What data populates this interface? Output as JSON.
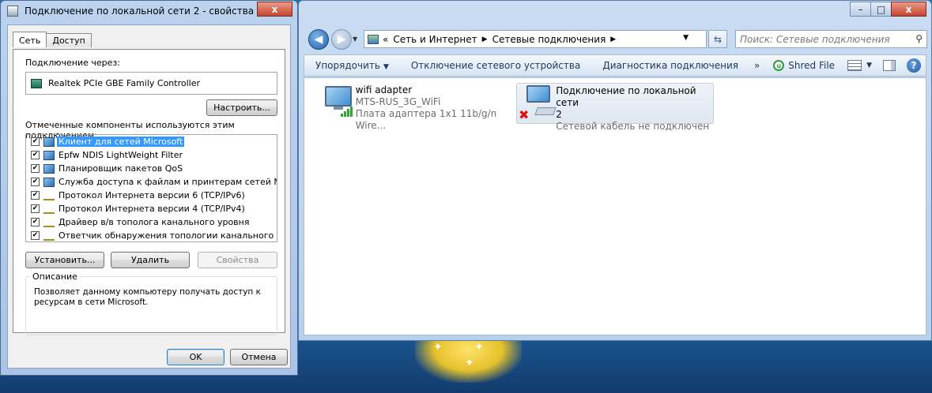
{
  "dialog": {
    "title": "Подключение по локальной сети 2 - свойства",
    "close_label": "x",
    "tabs": [
      {
        "label": "Сеть"
      },
      {
        "label": "Доступ"
      }
    ],
    "connect_using_label": "Подключение через:",
    "adapter_name": "Realtek PCIe GBE Family Controller",
    "configure_button": "Настроить...",
    "components_label": "Отмеченные компоненты используются этим подключением:",
    "components": [
      {
        "label": "Клиент для сетей Microsoft",
        "checked": true,
        "icon": "network-client-icon",
        "mark": "✔"
      },
      {
        "label": "Epfw NDIS LightWeight Filter",
        "checked": true,
        "icon": "network-service-icon",
        "mark": "✔"
      },
      {
        "label": "Планировщик пакетов QoS",
        "checked": true,
        "icon": "network-service-icon",
        "mark": "✔"
      },
      {
        "label": "Служба доступа к файлам и принтерам сетей Micro...",
        "checked": true,
        "icon": "network-service-icon",
        "mark": "✔"
      },
      {
        "label": "Протокол Интернета версии 6 (TCP/IPv6)",
        "checked": true,
        "icon": "protocol-icon",
        "mark": "✔"
      },
      {
        "label": "Протокол Интернета версии 4 (TCP/IPv4)",
        "checked": true,
        "icon": "protocol-icon",
        "mark": "✔"
      },
      {
        "label": "Драйвер в/в тополога канального уровня",
        "checked": true,
        "icon": "protocol-icon",
        "mark": "✔"
      },
      {
        "label": "Ответчик обнаружения топологии канального уровня",
        "checked": true,
        "icon": "protocol-icon",
        "mark": "✔"
      }
    ],
    "install_button": "Установить...",
    "remove_button": "Удалить",
    "properties_button": "Свойства",
    "description_title": "Описание",
    "description_text": "Позволяет данному компьютеру получать доступ к ресурсам в сети Microsoft.",
    "ok_button": "OK",
    "cancel_button": "Отмена"
  },
  "explorer": {
    "window_buttons": {
      "minimize": "–",
      "maximize": "□",
      "close": "x"
    },
    "breadcrumb": [
      "«",
      "Сеть и Интернет",
      "Сетевые подключения"
    ],
    "search_placeholder": "Поиск: Сетевые подключения",
    "toolbar": {
      "organize": "Упорядочить",
      "disable_device": "Отключение сетевого устройства",
      "diagnose": "Диагностика подключения",
      "more": "»",
      "shred_file": "Shred File"
    },
    "connections": [
      {
        "name": "wifi adapter",
        "line2": "MTS-RUS_3G_WiFi",
        "line3": "Плата адаптера 1x1 11b/g/n Wire...",
        "icon": "wifi-connection-icon",
        "signal_bars": 4,
        "status_color": "#2fa82f"
      },
      {
        "name": "Подключение по локальной сети",
        "name2": "2",
        "line3": "Сетевой кабель не подключен",
        "icon": "lan-connection-icon",
        "error_mark": "✖",
        "status_color": "#dd1111"
      }
    ]
  }
}
